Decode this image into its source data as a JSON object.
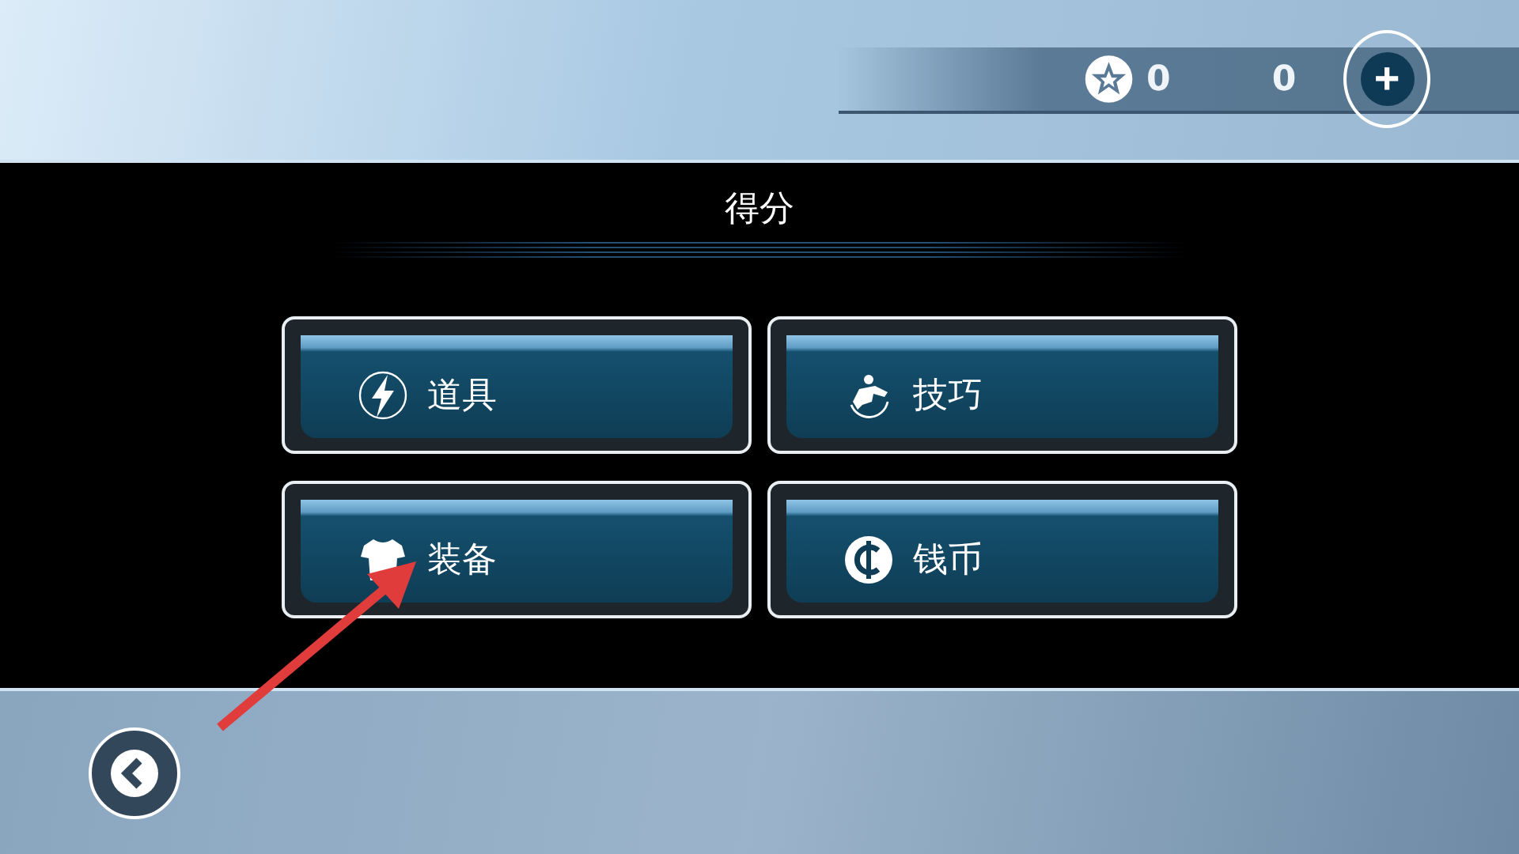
{
  "top_bar": {
    "stars": "0",
    "coins": "0",
    "add_button": "+"
  },
  "title": "得分",
  "menu": [
    {
      "label": "道具",
      "kind": "bolt"
    },
    {
      "label": "技巧",
      "kind": "skater"
    },
    {
      "label": "装备",
      "kind": "shirt"
    },
    {
      "label": "钱币",
      "kind": "coin"
    }
  ],
  "annotation": {
    "kind": "arrow",
    "color": "#e03c3c"
  }
}
